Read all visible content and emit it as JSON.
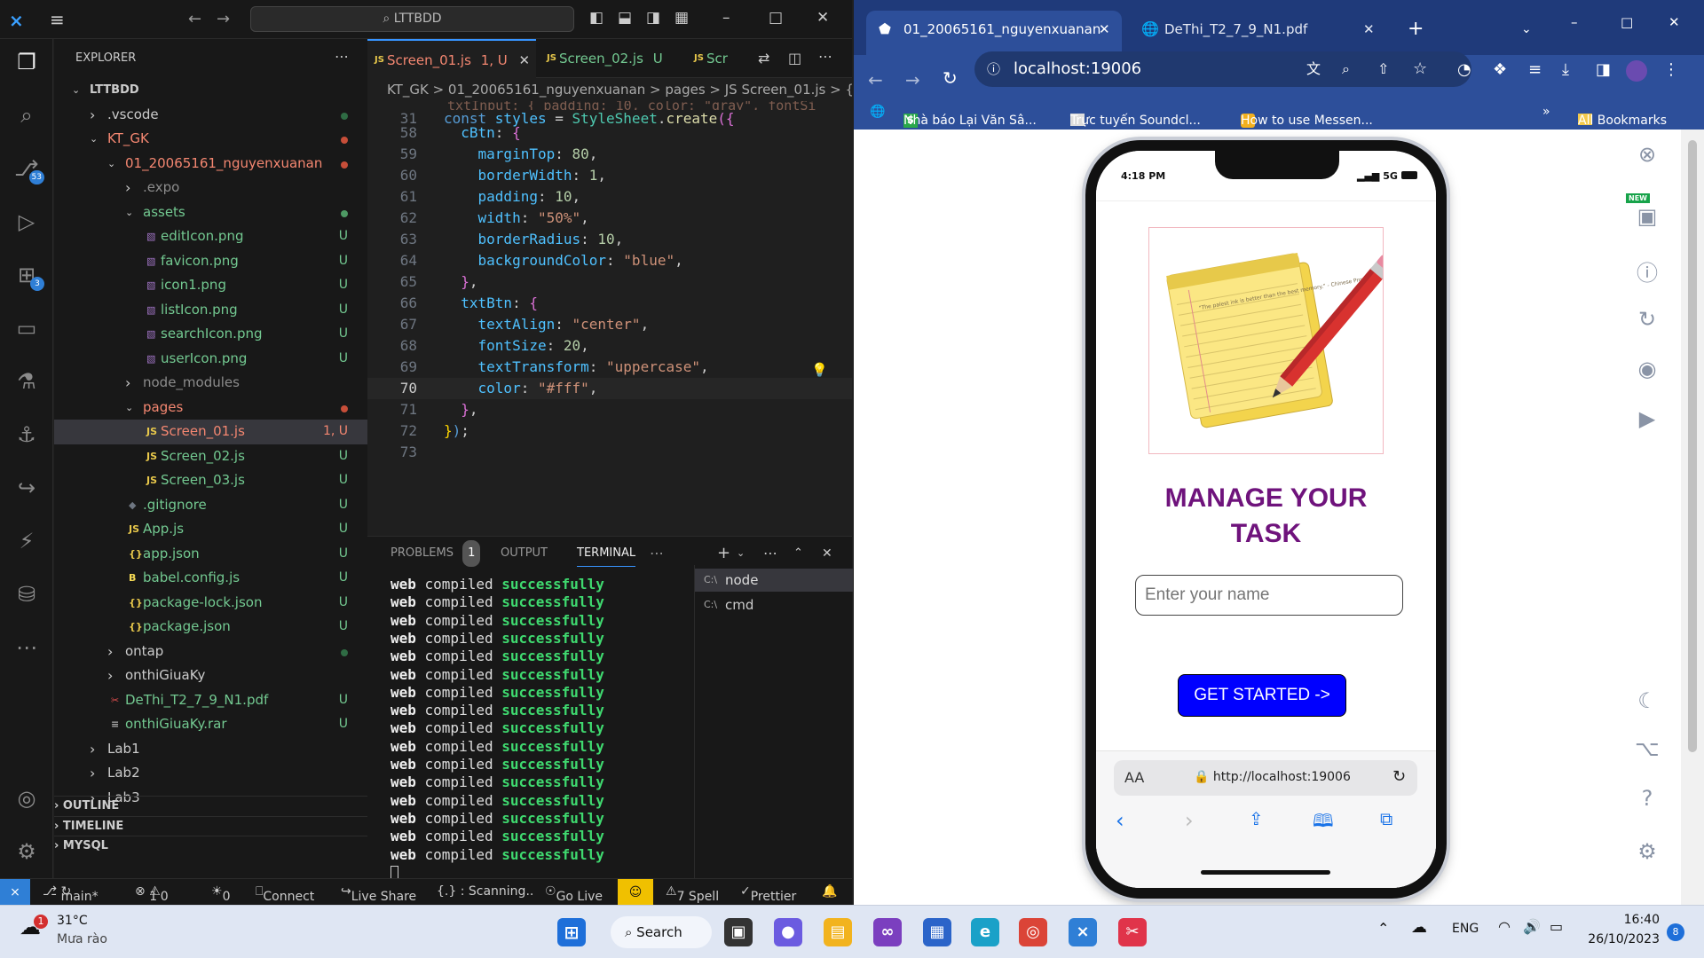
{
  "vscode": {
    "search": "LTTBDD",
    "explorer_title": "EXPLORER",
    "activity_badges": {
      "source_control": "53",
      "extensions": "3"
    },
    "tree": [
      {
        "label": "LTTBDD",
        "depth": 0,
        "arrow": "v",
        "bold": true
      },
      {
        "label": ".vscode",
        "depth": 1,
        "arrow": ">",
        "status": "dot",
        "color": "#cccccc"
      },
      {
        "label": "KT_GK",
        "depth": 1,
        "arrow": "v",
        "status": "dot",
        "color": "#f48771"
      },
      {
        "label": "01_20065161_nguyenxuanan",
        "depth": 2,
        "arrow": "v",
        "status": "dot",
        "color": "#f48771"
      },
      {
        "label": ".expo",
        "depth": 3,
        "arrow": ">",
        "color": "#8c8c8c"
      },
      {
        "label": "assets",
        "depth": 3,
        "arrow": "v",
        "status": "dot",
        "color": "#73c991"
      },
      {
        "label": "editIcon.png",
        "depth": 4,
        "icon": "img",
        "status": "U",
        "color": "#73c991"
      },
      {
        "label": "favicon.png",
        "depth": 4,
        "icon": "img",
        "status": "U",
        "color": "#73c991"
      },
      {
        "label": "icon1.png",
        "depth": 4,
        "icon": "img",
        "status": "U",
        "color": "#73c991"
      },
      {
        "label": "listIcon.png",
        "depth": 4,
        "icon": "img",
        "status": "U",
        "color": "#73c991"
      },
      {
        "label": "searchIcon.png",
        "depth": 4,
        "icon": "img",
        "status": "U",
        "color": "#73c991"
      },
      {
        "label": "userIcon.png",
        "depth": 4,
        "icon": "img",
        "status": "U",
        "color": "#73c991"
      },
      {
        "label": "node_modules",
        "depth": 3,
        "arrow": ">",
        "color": "#8c8c8c"
      },
      {
        "label": "pages",
        "depth": 3,
        "arrow": "v",
        "status": "dot",
        "color": "#f48771"
      },
      {
        "label": "Screen_01.js",
        "depth": 4,
        "icon": "JS",
        "status": "1, U",
        "color": "#f48771",
        "selected": true
      },
      {
        "label": "Screen_02.js",
        "depth": 4,
        "icon": "JS",
        "status": "U",
        "color": "#73c991"
      },
      {
        "label": "Screen_03.js",
        "depth": 4,
        "icon": "JS",
        "status": "U",
        "color": "#73c991"
      },
      {
        "label": ".gitignore",
        "depth": 3,
        "icon": "git",
        "status": "U",
        "color": "#73c991"
      },
      {
        "label": "App.js",
        "depth": 3,
        "icon": "JS",
        "status": "U",
        "color": "#73c991"
      },
      {
        "label": "app.json",
        "depth": 3,
        "icon": "{}",
        "status": "U",
        "color": "#73c991"
      },
      {
        "label": "babel.config.js",
        "depth": 3,
        "icon": "B",
        "status": "U",
        "color": "#73c991"
      },
      {
        "label": "package-lock.json",
        "depth": 3,
        "icon": "{}",
        "status": "U",
        "color": "#73c991"
      },
      {
        "label": "package.json",
        "depth": 3,
        "icon": "{}",
        "status": "U",
        "color": "#73c991"
      },
      {
        "label": "ontap",
        "depth": 2,
        "arrow": ">",
        "status": "dot",
        "color": "#cccccc"
      },
      {
        "label": "onthiGiuaKy",
        "depth": 2,
        "arrow": ">",
        "color": "#cccccc"
      },
      {
        "label": "DeThi_T2_7_9_N1.pdf",
        "depth": 2,
        "icon": "pdf",
        "status": "U",
        "color": "#73c991"
      },
      {
        "label": "onthiGiuaKy.rar",
        "depth": 2,
        "icon": "≡",
        "status": "U",
        "color": "#73c991"
      },
      {
        "label": "Lab1",
        "depth": 1,
        "arrow": ">",
        "color": "#cccccc"
      },
      {
        "label": "Lab2",
        "depth": 1,
        "arrow": ">",
        "color": "#cccccc"
      },
      {
        "label": "Lab3",
        "depth": 1,
        "arrow": ">",
        "color": "#cccccc"
      }
    ],
    "sections": [
      "OUTLINE",
      "TIMELINE",
      "MYSQL"
    ],
    "tabs": [
      {
        "label": "Screen_01.js",
        "status": "1, U",
        "active": true
      },
      {
        "label": "Screen_02.js",
        "status": "U",
        "active": false
      },
      {
        "label": "Scr",
        "status": "",
        "active": false
      }
    ],
    "breadcrumb": "KT_GK > 01_20065161_nguyenxuanan > pages > JS Screen_01.js > {} st",
    "code_lines": [
      {
        "n": "31",
        "parts": [
          [
            "kw",
            "const "
          ],
          [
            "vr",
            "styles"
          ],
          [
            "wh",
            " = "
          ],
          [
            "ty",
            "StyleSheet"
          ],
          [
            "wh",
            "."
          ],
          [
            "fn",
            "create"
          ],
          [
            "pu",
            "({"
          ]
        ]
      },
      {
        "n": "58",
        "parts": [
          [
            "wh",
            "  "
          ],
          [
            "vr",
            "cBtn"
          ],
          [
            "wh",
            ": "
          ],
          [
            "pu",
            "{"
          ]
        ]
      },
      {
        "n": "59",
        "parts": [
          [
            "wh",
            "    "
          ],
          [
            "vr",
            "marginTop"
          ],
          [
            "wh",
            ": "
          ],
          [
            "nm",
            "80"
          ],
          [
            "wh",
            ","
          ]
        ]
      },
      {
        "n": "60",
        "parts": [
          [
            "wh",
            "    "
          ],
          [
            "vr",
            "borderWidth"
          ],
          [
            "wh",
            ": "
          ],
          [
            "nm",
            "1"
          ],
          [
            "wh",
            ","
          ]
        ]
      },
      {
        "n": "61",
        "parts": [
          [
            "wh",
            "    "
          ],
          [
            "vr",
            "padding"
          ],
          [
            "wh",
            ": "
          ],
          [
            "nm",
            "10"
          ],
          [
            "wh",
            ","
          ]
        ]
      },
      {
        "n": "62",
        "parts": [
          [
            "wh",
            "    "
          ],
          [
            "vr",
            "width"
          ],
          [
            "wh",
            ": "
          ],
          [
            "st",
            "\"50%\""
          ],
          [
            "wh",
            ","
          ]
        ]
      },
      {
        "n": "63",
        "parts": [
          [
            "wh",
            "    "
          ],
          [
            "vr",
            "borderRadius"
          ],
          [
            "wh",
            ": "
          ],
          [
            "nm",
            "10"
          ],
          [
            "wh",
            ","
          ]
        ]
      },
      {
        "n": "64",
        "parts": [
          [
            "wh",
            "    "
          ],
          [
            "vr",
            "backgroundColor"
          ],
          [
            "wh",
            ": "
          ],
          [
            "st",
            "\"blue\""
          ],
          [
            "wh",
            ","
          ]
        ]
      },
      {
        "n": "65",
        "parts": [
          [
            "wh",
            "  "
          ],
          [
            "pu",
            "}"
          ],
          [
            "wh",
            ","
          ]
        ]
      },
      {
        "n": "66",
        "parts": [
          [
            "wh",
            "  "
          ],
          [
            "vr",
            "txtBtn"
          ],
          [
            "wh",
            ": "
          ],
          [
            "pu",
            "{"
          ]
        ]
      },
      {
        "n": "67",
        "parts": [
          [
            "wh",
            "    "
          ],
          [
            "vr",
            "textAlign"
          ],
          [
            "wh",
            ": "
          ],
          [
            "st",
            "\"center\""
          ],
          [
            "wh",
            ","
          ]
        ]
      },
      {
        "n": "68",
        "parts": [
          [
            "wh",
            "    "
          ],
          [
            "vr",
            "fontSize"
          ],
          [
            "wh",
            ": "
          ],
          [
            "nm",
            "20"
          ],
          [
            "wh",
            ","
          ]
        ]
      },
      {
        "n": "69",
        "parts": [
          [
            "wh",
            "    "
          ],
          [
            "vr",
            "textTransform"
          ],
          [
            "wh",
            ": "
          ],
          [
            "st",
            "\"uppercase\""
          ],
          [
            "wh",
            ","
          ]
        ]
      },
      {
        "n": "70",
        "parts": [
          [
            "wh",
            "    "
          ],
          [
            "vr",
            "color"
          ],
          [
            "wh",
            ": "
          ],
          [
            "st",
            "\"#fff\""
          ],
          [
            "wh",
            ","
          ]
        ]
      },
      {
        "n": "71",
        "parts": [
          [
            "wh",
            "  "
          ],
          [
            "pu",
            "}"
          ],
          [
            "wh",
            ","
          ]
        ]
      },
      {
        "n": "72",
        "parts": [
          [
            "yl",
            "}"
          ],
          [
            "kw",
            ")"
          ],
          [
            "wh",
            ";"
          ]
        ]
      },
      {
        "n": "73",
        "parts": []
      }
    ],
    "panel_tabs": [
      "PROBLEMS",
      "OUTPUT",
      "TERMINAL"
    ],
    "problems_count": "1",
    "terminal_lines": [
      "web compiled successfully",
      "web compiled successfully",
      "web compiled successfully",
      "web compiled successfully",
      "web compiled successfully",
      "web compiled successfully",
      "web compiled successfully",
      "web compiled successfully",
      "web compiled successfully",
      "web compiled successfully",
      "web compiled successfully",
      "web compiled successfully",
      "web compiled successfully",
      "web compiled successfully",
      "web compiled successfully",
      "web compiled successfully"
    ],
    "terminals": [
      "node",
      "cmd"
    ],
    "status": {
      "branch": "main*",
      "errors": "1",
      "warnings": "0",
      "ports": "0",
      "connect": "Connect",
      "live_share": "Live Share",
      "scanning": "{.} : Scanning..",
      "go_live": "Go Live",
      "spell": "7 Spell",
      "prettier": "Prettier"
    }
  },
  "chrome": {
    "tabs": [
      {
        "title": "01_20065161_nguyenxuanan",
        "active": true
      },
      {
        "title": "DeThi_T2_7_9_N1.pdf",
        "active": false
      }
    ],
    "url": "localhost:19006",
    "bookmarks": [
      "Nhà báo Lại Văn Sâ...",
      "Trực tuyến Soundcl...",
      "How to use Messen...",
      "All Bookmarks"
    ],
    "phone": {
      "time": "4:18 PM",
      "network": "5G",
      "heading_line1": "MANAGE YOUR",
      "heading_line2": "TASK",
      "input_placeholder": "Enter your name",
      "button": "GET STARTED ->",
      "aa": "AA",
      "address": "http://localhost:19006",
      "note_text": "\"The palest ink is better than the best memory.\" - Chinese Proverb"
    },
    "side_new_badge": "NEW"
  },
  "taskbar": {
    "weather_temp": "31°C",
    "weather_desc": "Mưa rào",
    "weather_badge": "1",
    "search": "Search",
    "lang": "ENG",
    "time": "16:40",
    "date": "26/10/2023",
    "notif": "8"
  }
}
